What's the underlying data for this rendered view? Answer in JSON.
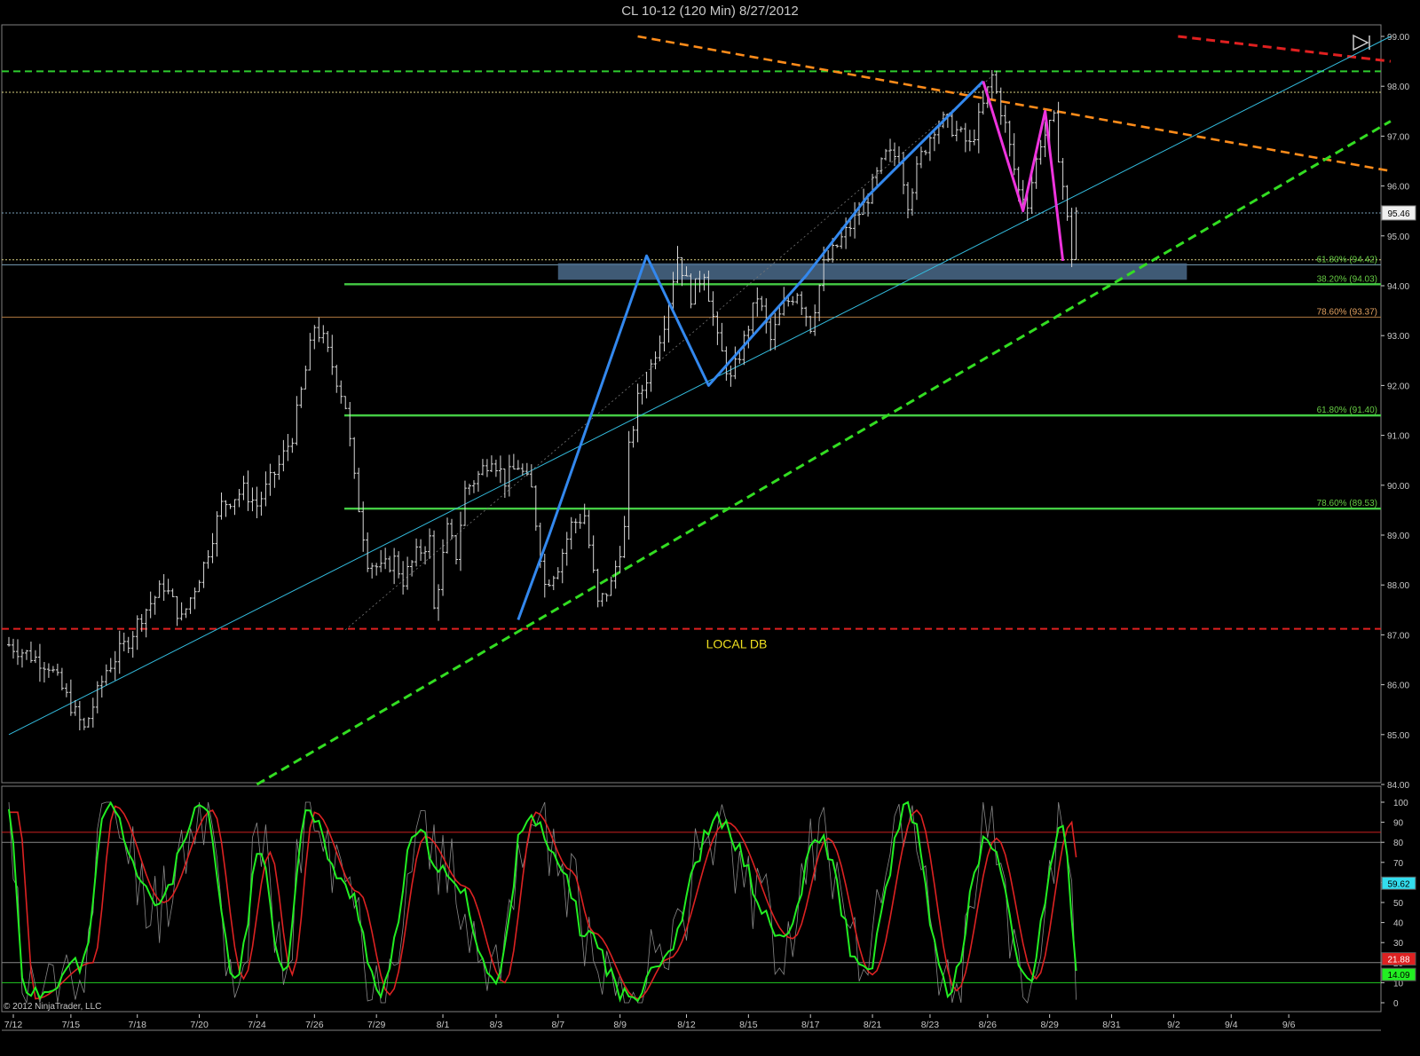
{
  "window": {
    "title": "CL 10-12 (120 Min)  8/27/2012"
  },
  "copyright": "© 2012 NinjaTrader, LLC",
  "colors": {
    "background": "#000000",
    "bar": "#d8d8d8",
    "fib_green": "#44cc44",
    "fib_label_green": "#66cc44",
    "fib_label_orange": "#e0a060",
    "support_red": "#e02020",
    "trend_orange": "#ff8c1a",
    "trend_green": "#33dd22",
    "channel_cyan": "#33bbdd",
    "wave_blue": "#3388ee",
    "wave_magenta": "#ee33dd",
    "zone": "#4a6a8a",
    "local_db_text": "#f0e020",
    "stoch_k": "#22ee22",
    "stoch_d": "#dd2222",
    "stoch_raw": "#888888",
    "overbought_line": "#cc2222",
    "oversold_line": "#22cc22"
  },
  "chart_data": [
    {
      "type": "candlestick",
      "subtype": "ohlc-bars",
      "instrument": "CL 10-12",
      "timeframe": "120 Min",
      "ylim": [
        84.0,
        99.1
      ],
      "y_ticks": [
        "84.00",
        "85.00",
        "86.00",
        "87.00",
        "88.00",
        "89.00",
        "90.00",
        "91.00",
        "92.00",
        "93.00",
        "94.00",
        "95.00",
        "96.00",
        "97.00",
        "98.00",
        "99.00"
      ],
      "x_ticks": [
        "7/12",
        "7/15",
        "7/18",
        "7/20",
        "7/24",
        "7/26",
        "7/29",
        "8/1",
        "8/3",
        "8/7",
        "8/9",
        "8/12",
        "8/15",
        "8/17",
        "8/21",
        "8/23",
        "8/26",
        "8/29",
        "8/31",
        "9/2",
        "9/4",
        "9/6"
      ],
      "price_path": [
        [
          0,
          86.8
        ],
        [
          9,
          86.4
        ],
        [
          17,
          85.1
        ],
        [
          22,
          86.3
        ],
        [
          27,
          86.9
        ],
        [
          30,
          87.4
        ],
        [
          35,
          88.0
        ],
        [
          39,
          87.3
        ],
        [
          44,
          88.4
        ],
        [
          48,
          89.6
        ],
        [
          53,
          89.9
        ],
        [
          56,
          89.6
        ],
        [
          61,
          90.4
        ],
        [
          64,
          91.0
        ],
        [
          67,
          92.3
        ],
        [
          69,
          93.2
        ],
        [
          71,
          92.9
        ],
        [
          73,
          92.4
        ],
        [
          76,
          91.6
        ],
        [
          78,
          90.1
        ],
        [
          81,
          88.5
        ],
        [
          84,
          88.3
        ],
        [
          87,
          88.5
        ],
        [
          89,
          88.1
        ],
        [
          92,
          88.6
        ],
        [
          95,
          88.9
        ],
        [
          96,
          87.5
        ],
        [
          99,
          89.1
        ],
        [
          101,
          88.6
        ],
        [
          103,
          89.9
        ],
        [
          106,
          90.2
        ],
        [
          109,
          90.6
        ],
        [
          112,
          90.1
        ],
        [
          115,
          90.4
        ],
        [
          118,
          89.9
        ],
        [
          121,
          88.0
        ],
        [
          124,
          88.4
        ],
        [
          127,
          89.2
        ],
        [
          130,
          89.4
        ],
        [
          133,
          87.6
        ],
        [
          136,
          88.0
        ],
        [
          139,
          89.1
        ],
        [
          140,
          90.7
        ],
        [
          142,
          91.7
        ],
        [
          145,
          92.4
        ],
        [
          148,
          93.3
        ],
        [
          151,
          94.6
        ],
        [
          154,
          93.8
        ],
        [
          157,
          94.3
        ],
        [
          160,
          92.9
        ],
        [
          163,
          92.1
        ],
        [
          166,
          92.9
        ],
        [
          169,
          93.8
        ],
        [
          172,
          92.9
        ],
        [
          175,
          93.6
        ],
        [
          178,
          93.9
        ],
        [
          181,
          93.2
        ],
        [
          184,
          94.4
        ],
        [
          187,
          94.8
        ],
        [
          190,
          95.2
        ],
        [
          193,
          95.6
        ],
        [
          195,
          96.0
        ],
        [
          198,
          96.6
        ],
        [
          201,
          96.6
        ],
        [
          203,
          95.7
        ],
        [
          206,
          96.6
        ],
        [
          209,
          97.2
        ],
        [
          211,
          97.3
        ],
        [
          214,
          97.1
        ],
        [
          217,
          96.8
        ],
        [
          220,
          97.6
        ],
        [
          222,
          98.2
        ],
        [
          225,
          97.2
        ],
        [
          228,
          95.9
        ],
        [
          230,
          95.7
        ],
        [
          233,
          96.9
        ],
        [
          236,
          97.3
        ],
        [
          238,
          96.0
        ],
        [
          240,
          94.6
        ],
        [
          241,
          95.5
        ]
      ],
      "total_bars": 242,
      "last_price": "95.46",
      "horizontal_levels": [
        {
          "price": 98.3,
          "style": "dashed",
          "color": "#2ecc2e"
        },
        {
          "price": 97.88,
          "style": "dotted",
          "color": "#d8d080"
        },
        {
          "price": 95.46,
          "style": "dotted",
          "color": "#7aa0b8"
        },
        {
          "price": 94.52,
          "style": "dotted",
          "color": "#d8d080"
        },
        {
          "price": 94.42,
          "style": "solid-thin",
          "color": "#7aa0b8",
          "label": "61.80% (94.42)"
        },
        {
          "price": 94.03,
          "style": "solid",
          "color": "#44cc44",
          "label": "38.20% (94.03)"
        },
        {
          "price": 93.37,
          "style": "solid-thin",
          "color": "#b07840",
          "label": "78.60% (93.37)"
        },
        {
          "price": 91.4,
          "style": "solid",
          "color": "#44cc44",
          "label": "61.80% (91.40)"
        },
        {
          "price": 89.53,
          "style": "solid",
          "color": "#44cc44",
          "label": "78.60% (89.53)"
        },
        {
          "price": 87.12,
          "style": "dashed",
          "color": "#e02020"
        }
      ],
      "zone": {
        "price_top": 94.45,
        "price_bottom": 94.12,
        "from_bar": 124,
        "to_bar": 266
      },
      "trendlines": [
        {
          "name": "upper-orange",
          "from": [
            142,
            99.0
          ],
          "to": [
            312,
            96.3
          ],
          "style": "dashed"
        },
        {
          "name": "upper-red",
          "from": [
            264,
            99.0
          ],
          "to": [
            312,
            98.5
          ],
          "style": "dashed"
        },
        {
          "name": "lower-green",
          "from": [
            56,
            84.0
          ],
          "to": [
            312,
            97.3
          ],
          "style": "dashed"
        },
        {
          "name": "channel-cyan",
          "from": [
            0,
            85.0
          ],
          "to": [
            312,
            99.0
          ],
          "style": "solid-thin"
        }
      ],
      "wave_blue": [
        [
          115,
          87.3
        ],
        [
          122,
          89.0
        ],
        [
          144,
          94.6
        ],
        [
          158,
          92.0
        ],
        [
          180,
          94.2
        ],
        [
          194,
          95.8
        ],
        [
          220,
          98.1
        ]
      ],
      "wave_magenta": [
        [
          220,
          98.1
        ],
        [
          229,
          95.5
        ],
        [
          234,
          97.5
        ],
        [
          238,
          94.5
        ]
      ],
      "annotation": "LOCAL DB"
    },
    {
      "type": "line",
      "indicator": "stochastics",
      "ylim": [
        -5,
        105
      ],
      "y_ticks": [
        "0",
        "10",
        "20",
        "30",
        "40",
        "50",
        "60",
        "70",
        "80",
        "90",
        "100"
      ],
      "levels": [
        85,
        80,
        20,
        10
      ],
      "readouts": {
        "raw": "59.62",
        "d": "21.88",
        "k": "14.09"
      },
      "cycle_lows": [
        [
          0,
          95
        ],
        [
          4,
          2
        ],
        [
          17,
          20
        ],
        [
          22,
          98
        ],
        [
          33,
          50
        ],
        [
          44,
          96
        ],
        [
          51,
          12
        ],
        [
          57,
          75
        ],
        [
          62,
          14
        ],
        [
          67,
          95
        ],
        [
          77,
          55
        ],
        [
          84,
          4
        ],
        [
          92,
          83
        ],
        [
          101,
          58
        ],
        [
          110,
          10
        ],
        [
          117,
          95
        ],
        [
          125,
          66
        ],
        [
          130,
          35
        ],
        [
          140,
          2
        ],
        [
          147,
          22
        ],
        [
          160,
          90
        ],
        [
          175,
          32
        ],
        [
          183,
          82
        ],
        [
          193,
          14
        ],
        [
          203,
          96
        ],
        [
          212,
          6
        ],
        [
          221,
          82
        ],
        [
          230,
          12
        ],
        [
          238,
          90
        ],
        [
          241,
          20
        ]
      ]
    }
  ]
}
